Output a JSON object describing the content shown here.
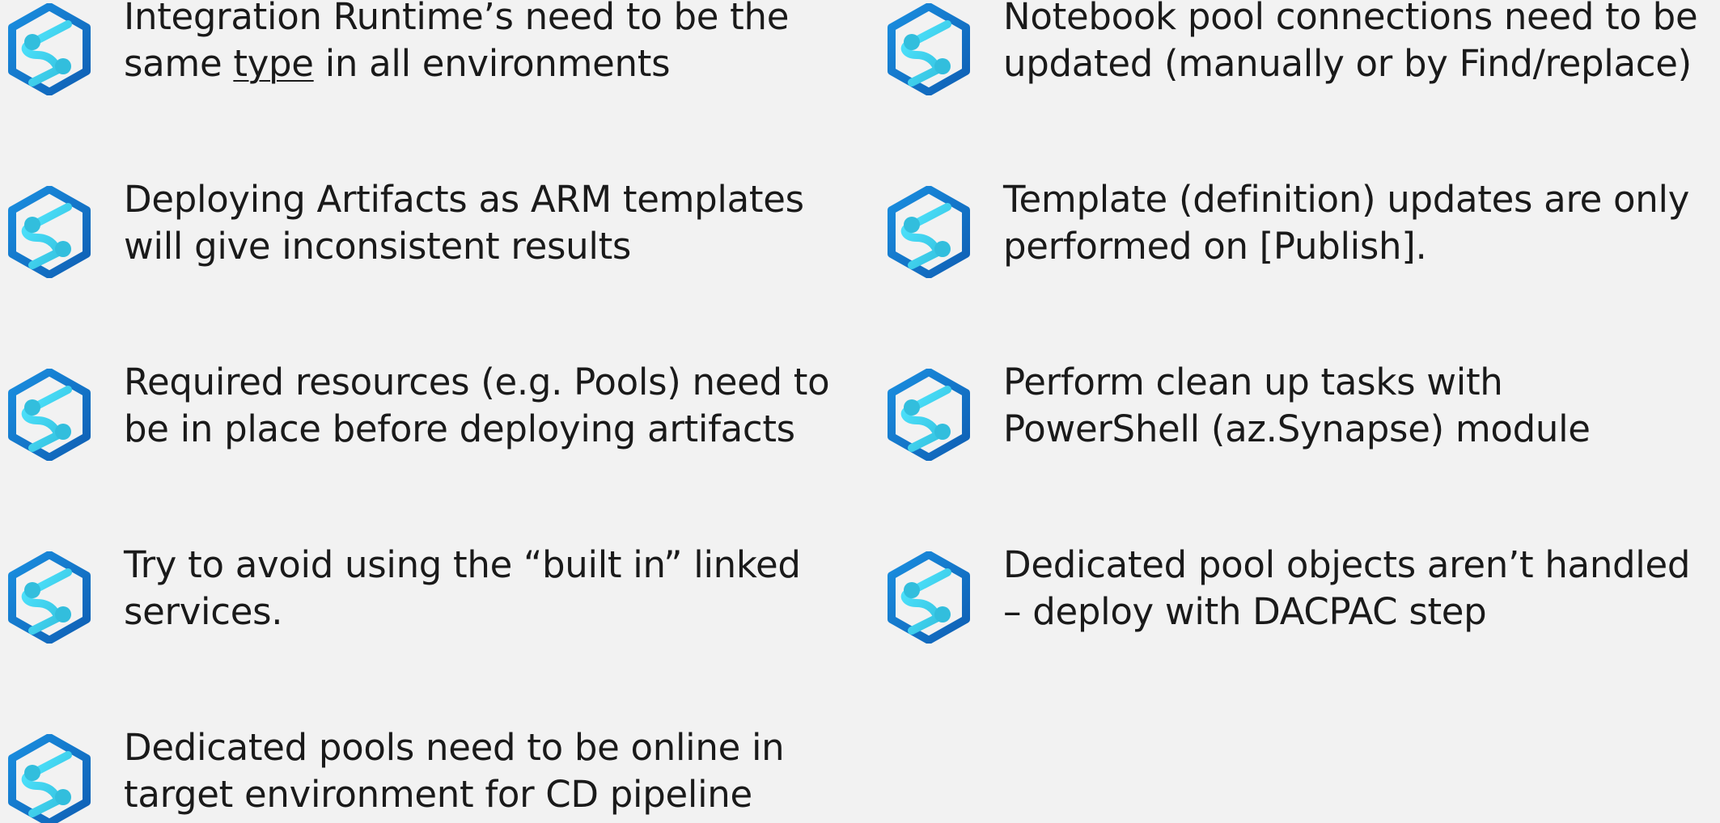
{
  "items": [
    {
      "icon": "synapse-icon",
      "line1": "Integration Runtime’s need to be the",
      "line2_pre": "same ",
      "line2_underline": "type",
      "line2_post": " in all environments"
    },
    {
      "icon": "synapse-icon",
      "line1": "Deploying Artifacts as ARM templates",
      "line2": "will give inconsistent results"
    },
    {
      "icon": "synapse-icon",
      "line1": "Required resources (e.g. Pools) need to",
      "line2": "be in place before deploying artifacts"
    },
    {
      "icon": "synapse-icon",
      "line1": "Try to avoid using the “built in” linked",
      "line2": "services."
    },
    {
      "icon": "synapse-icon",
      "line1": "Dedicated pools need to be online in",
      "line2": "target environment for CD pipeline"
    },
    {
      "icon": "synapse-icon",
      "line1": "Notebook pool connections need to be",
      "line2": "updated (manually or by Find/replace)"
    },
    {
      "icon": "synapse-icon",
      "line1": "Template (definition) updates are only",
      "line2": "performed on [Publish]."
    },
    {
      "icon": "synapse-icon",
      "line1": "Perform clean up tasks with",
      "line2": "PowerShell (az.Synapse) module"
    },
    {
      "icon": "synapse-icon",
      "line1": "Dedicated pool objects aren’t handled",
      "line2": "– deploy with DACPAC step"
    }
  ],
  "colors": {
    "background": "#f2f2f2",
    "text": "#1a1a1a",
    "hex_dark": "#0f5fb4",
    "hex_light": "#1a8fe0",
    "accent_cyan": "#50e6ff",
    "accent_teal": "#32bedd"
  }
}
